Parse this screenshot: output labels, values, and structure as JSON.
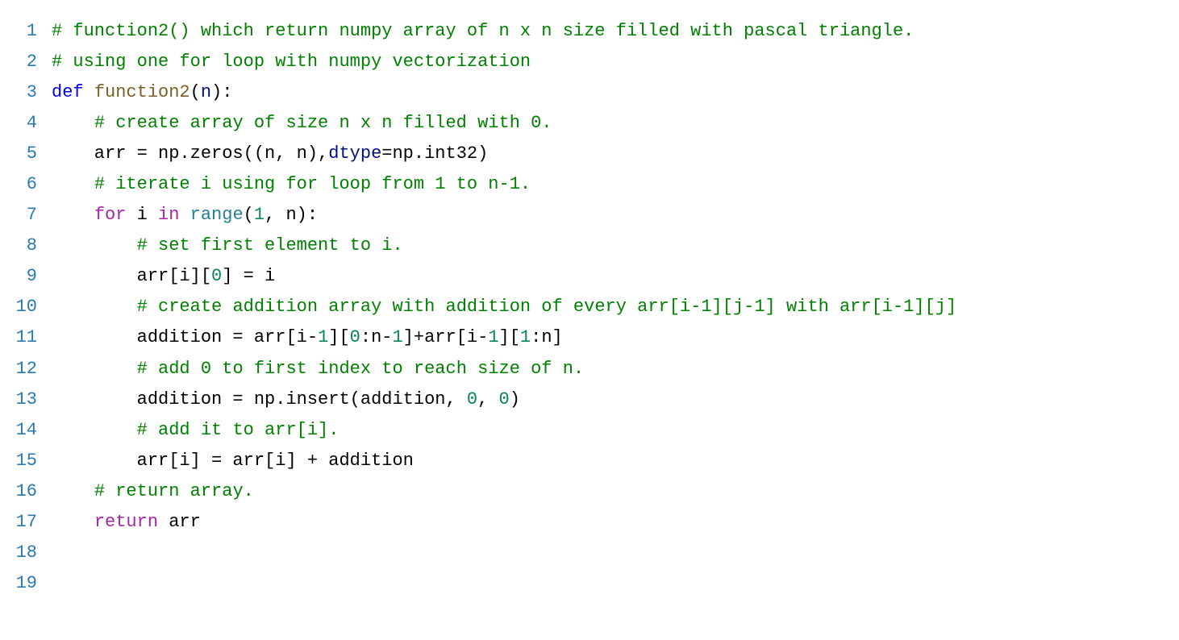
{
  "language": "python",
  "line_count": 19,
  "code_lines": [
    [
      {
        "cls": "tok-comment",
        "t": "# function2() which return numpy array of n x n size filled with pascal triangle."
      }
    ],
    [
      {
        "cls": "tok-comment",
        "t": "# using one for loop with numpy vectorization"
      }
    ],
    [
      {
        "cls": "tok-keyword",
        "t": "def"
      },
      {
        "cls": "tok-ident",
        "t": " "
      },
      {
        "cls": "tok-func",
        "t": "function2"
      },
      {
        "cls": "tok-op",
        "t": "("
      },
      {
        "cls": "tok-param",
        "t": "n"
      },
      {
        "cls": "tok-op",
        "t": "):"
      }
    ],
    [
      {
        "cls": "tok-ident",
        "t": "    "
      },
      {
        "cls": "tok-comment",
        "t": "# create array of size n x n filled with 0."
      }
    ],
    [
      {
        "cls": "tok-ident",
        "t": "    arr = np.zeros((n, n),"
      },
      {
        "cls": "tok-param",
        "t": "dtype"
      },
      {
        "cls": "tok-ident",
        "t": "=np.int32)"
      }
    ],
    [
      {
        "cls": "tok-ident",
        "t": "    "
      },
      {
        "cls": "tok-comment",
        "t": "# iterate i using for loop from 1 to n-1."
      }
    ],
    [
      {
        "cls": "tok-ident",
        "t": "    "
      },
      {
        "cls": "tok-flowkw",
        "t": "for"
      },
      {
        "cls": "tok-ident",
        "t": " i "
      },
      {
        "cls": "tok-flowkw",
        "t": "in"
      },
      {
        "cls": "tok-ident",
        "t": " "
      },
      {
        "cls": "tok-builtin",
        "t": "range"
      },
      {
        "cls": "tok-ident",
        "t": "("
      },
      {
        "cls": "tok-number",
        "t": "1"
      },
      {
        "cls": "tok-ident",
        "t": ", n):"
      }
    ],
    [
      {
        "cls": "tok-ident",
        "t": "        "
      },
      {
        "cls": "tok-comment",
        "t": "# set first element to i."
      }
    ],
    [
      {
        "cls": "tok-ident",
        "t": "        arr[i]["
      },
      {
        "cls": "tok-number",
        "t": "0"
      },
      {
        "cls": "tok-ident",
        "t": "] = i"
      }
    ],
    [
      {
        "cls": "tok-ident",
        "t": "        "
      },
      {
        "cls": "tok-comment",
        "t": "# create addition array with addition of every arr[i-1][j-1] with arr[i-1][j]"
      }
    ],
    [
      {
        "cls": "tok-ident",
        "t": "        addition = arr[i-"
      },
      {
        "cls": "tok-number",
        "t": "1"
      },
      {
        "cls": "tok-ident",
        "t": "]["
      },
      {
        "cls": "tok-number",
        "t": "0"
      },
      {
        "cls": "tok-ident",
        "t": ":n-"
      },
      {
        "cls": "tok-number",
        "t": "1"
      },
      {
        "cls": "tok-ident",
        "t": "]+arr[i-"
      },
      {
        "cls": "tok-number",
        "t": "1"
      },
      {
        "cls": "tok-ident",
        "t": "]["
      },
      {
        "cls": "tok-number",
        "t": "1"
      },
      {
        "cls": "tok-ident",
        "t": ":n]"
      }
    ],
    [
      {
        "cls": "tok-ident",
        "t": "        "
      },
      {
        "cls": "tok-comment",
        "t": "# add 0 to first index to reach size of n."
      }
    ],
    [
      {
        "cls": "tok-ident",
        "t": "        addition = np.insert(addition, "
      },
      {
        "cls": "tok-number",
        "t": "0"
      },
      {
        "cls": "tok-ident",
        "t": ", "
      },
      {
        "cls": "tok-number",
        "t": "0"
      },
      {
        "cls": "tok-ident",
        "t": ")"
      }
    ],
    [
      {
        "cls": "tok-ident",
        "t": "        "
      },
      {
        "cls": "tok-comment",
        "t": "# add it to arr[i]."
      }
    ],
    [
      {
        "cls": "tok-ident",
        "t": "        arr[i] = arr[i] + addition"
      }
    ],
    [
      {
        "cls": "tok-ident",
        "t": "    "
      },
      {
        "cls": "tok-comment",
        "t": "# return array."
      }
    ],
    [
      {
        "cls": "tok-ident",
        "t": "    "
      },
      {
        "cls": "tok-flowkw",
        "t": "return"
      },
      {
        "cls": "tok-ident",
        "t": " arr"
      }
    ],
    [
      {
        "cls": "tok-ident",
        "t": ""
      }
    ],
    [
      {
        "cls": "tok-ident",
        "t": ""
      }
    ]
  ]
}
